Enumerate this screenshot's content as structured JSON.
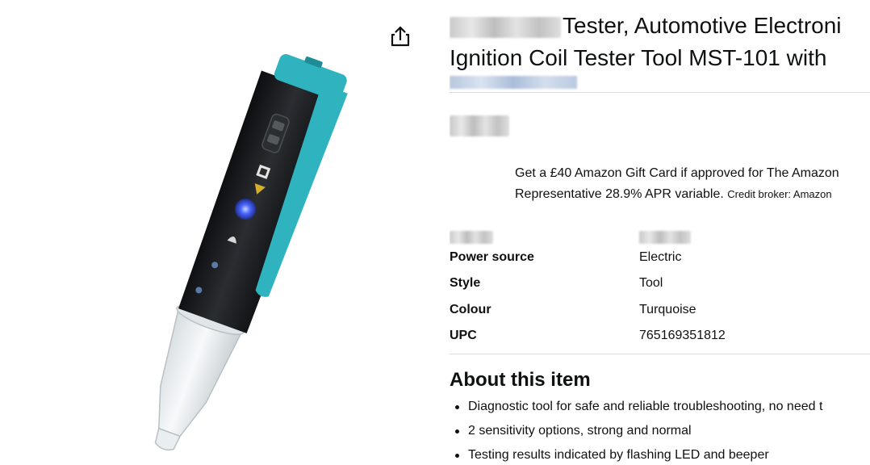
{
  "product": {
    "title_line1": "Tester, Automotive Electroni",
    "title_line2": "Ignition Coil Tester Tool MST-101 with",
    "title_brand_redacted": "",
    "store_link_redacted": "",
    "price_redacted": ""
  },
  "share": {
    "icon": "share-icon"
  },
  "credit_offer": {
    "line1": "Get a £40 Amazon Gift Card if approved for The Amazon",
    "line2_main": "Representative 28.9% APR variable. ",
    "line2_small": "Credit broker: Amazon"
  },
  "specs": [
    {
      "key": "",
      "value": "",
      "redacted": true
    },
    {
      "key": "Power source",
      "value": "Electric"
    },
    {
      "key": "Style",
      "value": "Tool"
    },
    {
      "key": "Colour",
      "value": "Turquoise"
    },
    {
      "key": "UPC",
      "value": "765169351812"
    }
  ],
  "about": {
    "heading": "About this item",
    "bullets": [
      "Diagnostic tool for safe and reliable troubleshooting, no need t",
      "2 sensitivity options, strong and normal",
      "Testing results indicated by flashing LED and beeper"
    ]
  },
  "colors": {
    "text": "#0f1111",
    "tester_body": "#1b1d1f",
    "tester_accent": "#2fb3bf",
    "tester_tip": "#e8eef1",
    "led_blue": "#3b5bff",
    "divider": "#dddddd"
  }
}
